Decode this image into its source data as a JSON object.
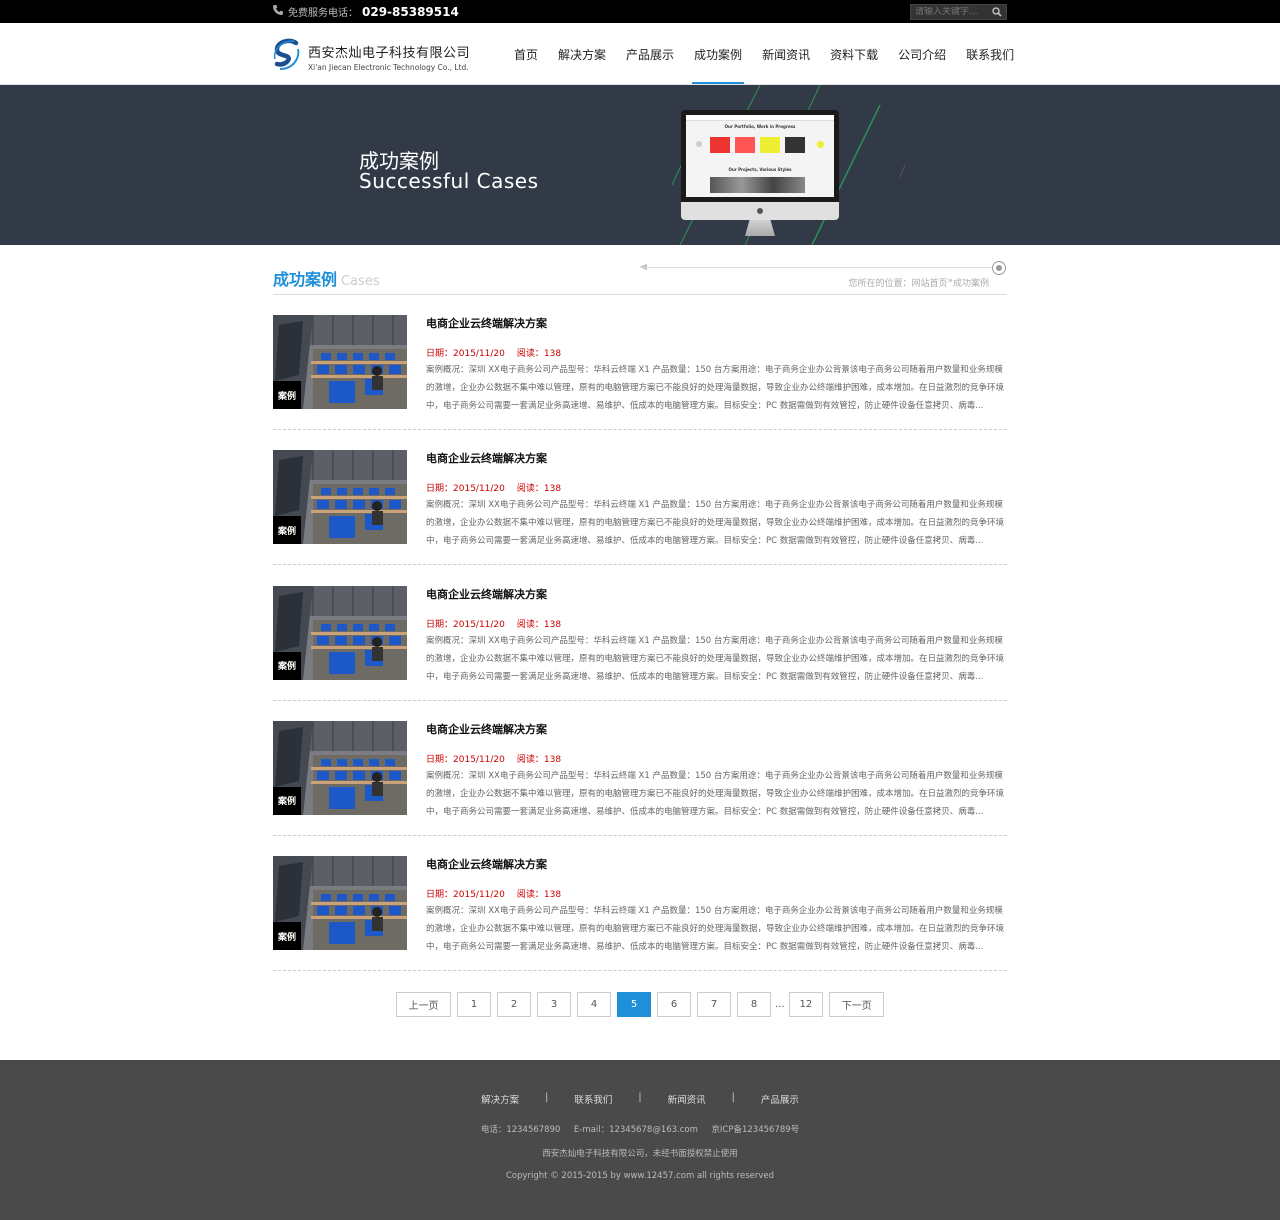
{
  "topbar": {
    "hotline_label": "免费服务电话：",
    "hotline_number": "029-85389514",
    "search_placeholder": "请输入关键字..."
  },
  "logo": {
    "name_cn": "西安杰灿电子科技有限公司",
    "name_en": "Xi'an Jiecan Electronic Technology Co., Ltd."
  },
  "nav": [
    {
      "label": "首页",
      "active": false
    },
    {
      "label": "解决方案",
      "active": false
    },
    {
      "label": "产品展示",
      "active": false
    },
    {
      "label": "成功案例",
      "active": true
    },
    {
      "label": "新闻资讯",
      "active": false
    },
    {
      "label": "资料下载",
      "active": false
    },
    {
      "label": "公司介绍",
      "active": false
    },
    {
      "label": "联系我们",
      "active": false
    }
  ],
  "banner": {
    "title_cn": "成功案例",
    "title_en": "Successful  Cases",
    "screen_heading": "Our Portfolio, Work in Progress",
    "screen_subheading": "Our Projects, Various Styles"
  },
  "section": {
    "title_cn": "成功案例",
    "title_en": "Cases",
    "breadcrumb_prefix": "您所在的位置：",
    "breadcrumb_home": "网站首页",
    "breadcrumb_sep": "»",
    "breadcrumb_current": "成功案例"
  },
  "cases": [
    {
      "tag": "案例",
      "title": "电商企业云终端解决方案",
      "date_label": "日期：",
      "date": "2015/11/20",
      "reads_label": "阅读：",
      "reads": "138",
      "desc": "案例概况：深圳 XX电子商务公司产品型号：华科云终端 X1 产品数量：150 台方案用途：电子商务企业办公背景该电子商务公司随着用户数量和业务规模的激增，企业办公数据不集中难以管理，原有的电脑管理方案已不能良好的处理海量数据，导致企业办公终端维护困难，成本增加。在日益激烈的竞争环境中，电子商务公司需要一套满足业务高速增、易维护、低成本的电脑管理方案。目标安全：PC 数据需做到有效管控，防止硬件设备任意拷贝、病毒..."
    },
    {
      "tag": "案例",
      "title": "电商企业云终端解决方案",
      "date_label": "日期：",
      "date": "2015/11/20",
      "reads_label": "阅读：",
      "reads": "138",
      "desc": "案例概况：深圳 XX电子商务公司产品型号：华科云终端 X1 产品数量：150 台方案用途：电子商务企业办公背景该电子商务公司随着用户数量和业务规模的激增，企业办公数据不集中难以管理，原有的电脑管理方案已不能良好的处理海量数据，导致企业办公终端维护困难，成本增加。在日益激烈的竞争环境中，电子商务公司需要一套满足业务高速增、易维护、低成本的电脑管理方案。目标安全：PC 数据需做到有效管控，防止硬件设备任意拷贝、病毒..."
    },
    {
      "tag": "案例",
      "title": "电商企业云终端解决方案",
      "date_label": "日期：",
      "date": "2015/11/20",
      "reads_label": "阅读：",
      "reads": "138",
      "desc": "案例概况：深圳 XX电子商务公司产品型号：华科云终端 X1 产品数量：150 台方案用途：电子商务企业办公背景该电子商务公司随着用户数量和业务规模的激增，企业办公数据不集中难以管理，原有的电脑管理方案已不能良好的处理海量数据，导致企业办公终端维护困难，成本增加。在日益激烈的竞争环境中，电子商务公司需要一套满足业务高速增、易维护、低成本的电脑管理方案。目标安全：PC 数据需做到有效管控，防止硬件设备任意拷贝、病毒..."
    },
    {
      "tag": "案例",
      "title": "电商企业云终端解决方案",
      "date_label": "日期：",
      "date": "2015/11/20",
      "reads_label": "阅读：",
      "reads": "138",
      "desc": "案例概况：深圳 XX电子商务公司产品型号：华科云终端 X1 产品数量：150 台方案用途：电子商务企业办公背景该电子商务公司随着用户数量和业务规模的激增，企业办公数据不集中难以管理，原有的电脑管理方案已不能良好的处理海量数据，导致企业办公终端维护困难，成本增加。在日益激烈的竞争环境中，电子商务公司需要一套满足业务高速增、易维护、低成本的电脑管理方案。目标安全：PC 数据需做到有效管控，防止硬件设备任意拷贝、病毒..."
    },
    {
      "tag": "案例",
      "title": "电商企业云终端解决方案",
      "date_label": "日期：",
      "date": "2015/11/20",
      "reads_label": "阅读：",
      "reads": "138",
      "desc": "案例概况：深圳 XX电子商务公司产品型号：华科云终端 X1 产品数量：150 台方案用途：电子商务企业办公背景该电子商务公司随着用户数量和业务规模的激增，企业办公数据不集中难以管理，原有的电脑管理方案已不能良好的处理海量数据，导致企业办公终端维护困难，成本增加。在日益激烈的竞争环境中，电子商务公司需要一套满足业务高速增、易维护、低成本的电脑管理方案。目标安全：PC 数据需做到有效管控，防止硬件设备任意拷贝、病毒..."
    }
  ],
  "pager": {
    "prev": "上一页",
    "pages": [
      "1",
      "2",
      "3",
      "4",
      "5",
      "6",
      "7",
      "8"
    ],
    "current": "5",
    "ellipsis": "...",
    "last": "12",
    "next": "下一页"
  },
  "footer": {
    "links": [
      "解决方案",
      "联系我们",
      "新闻资讯",
      "产品展示"
    ],
    "separator": "|",
    "contact": "电话：1234567890     E-mail：12345678@163.com     京ICP备123456789号",
    "company": "西安杰灿电子科技有限公司，未经书面授权禁止使用",
    "copyright": "Copyright © 2015-2015 by www.12457.com all rights reserved"
  },
  "colors": {
    "accent": "#1e8fd8",
    "banner_bg": "#333a47",
    "footer_bg": "#4a4a4a",
    "meta_red": "#cc0000"
  }
}
